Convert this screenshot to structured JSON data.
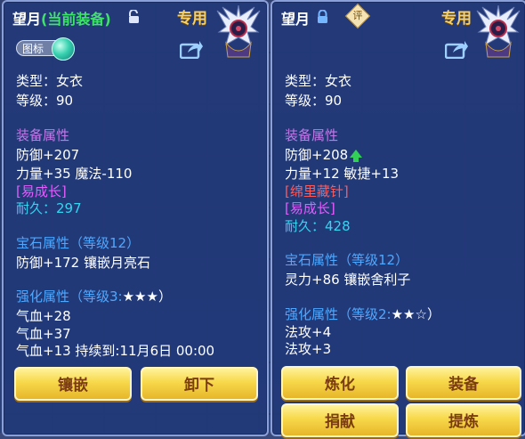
{
  "left": {
    "name": "望月",
    "current_tag": "(当前装备)",
    "special": "专用",
    "toggle_label": "图标",
    "type": "类型：女衣",
    "level": "等级：90",
    "equip_heading": "装备属性",
    "defense": "防御+207",
    "stats": "力量+35 魔法-110",
    "tag": "[易成长]",
    "durability_label": "耐久：",
    "durability_value": "297",
    "gem_heading": "宝石属性（等级12）",
    "gem_line": "防御+172 镶嵌月亮石",
    "enhance_heading": "强化属性（等级3:",
    "enhance_stars": "★★★）",
    "enhance_lines": [
      "气血+28",
      "气血+37",
      "气血+13    持续到:11月6日 00:00"
    ],
    "buttons": [
      "镶嵌",
      "卸下"
    ]
  },
  "right": {
    "name": "望月",
    "badge": "评",
    "special": "专用",
    "type": "类型：女衣",
    "level": "等级：90",
    "equip_heading": "装备属性",
    "defense": "防御+208",
    "stats": "力量+12 敏捷+13",
    "tag1": "[绵里藏针]",
    "tag2": "[易成长]",
    "durability_label": "耐久：",
    "durability_value": "428",
    "gem_heading": "宝石属性（等级12）",
    "gem_line": "灵力+86 镶嵌舍利子",
    "enhance_heading": "强化属性（等级2:",
    "enhance_stars": "★★☆）",
    "enhance_lines": [
      "法攻+4",
      "法攻+3"
    ],
    "buttons": [
      "炼化",
      "装备",
      "捐献",
      "提炼"
    ]
  },
  "colors": {
    "button": "#f7d84a",
    "panel": "#22387a",
    "heading": "#c079e8",
    "heading_blue": "#4ea8ff",
    "cyan": "#35d4f0"
  }
}
